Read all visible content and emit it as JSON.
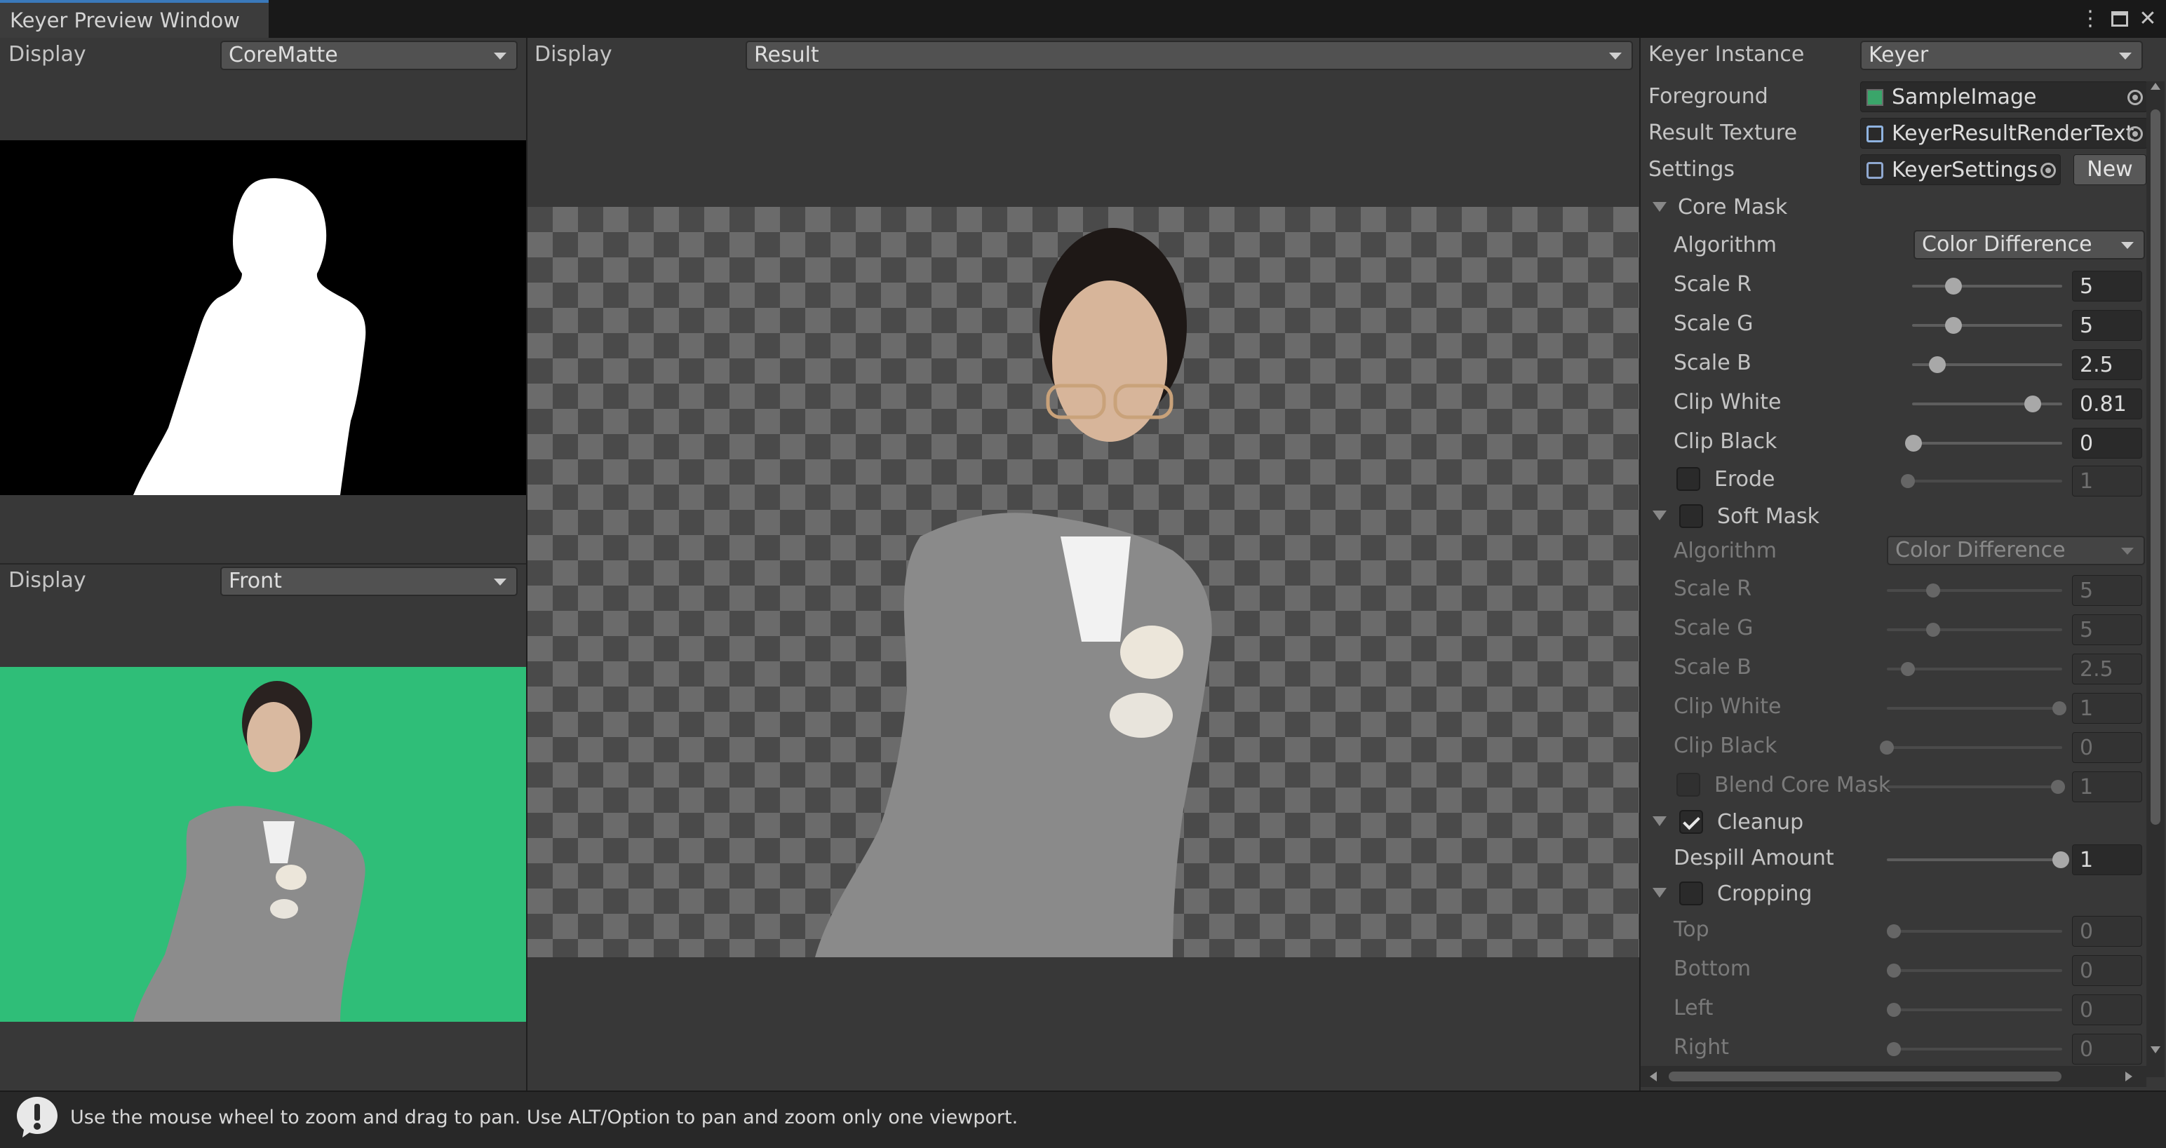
{
  "window": {
    "tab_title": "Keyer Preview Window"
  },
  "left_top": {
    "display_label": "Display",
    "display_value": "CoreMatte"
  },
  "left_bottom": {
    "display_label": "Display",
    "display_value": "Front"
  },
  "center": {
    "display_label": "Display",
    "display_value": "Result"
  },
  "inspector": {
    "instance_label": "Keyer Instance",
    "instance_value": "Keyer",
    "foreground_label": "Foreground",
    "foreground_value": "SampleImage",
    "result_label": "Result Texture",
    "result_value": "KeyerResultRenderText",
    "settings_label": "Settings",
    "settings_value": "KeyerSettings",
    "new_label": "New",
    "core_mask": {
      "title": "Core Mask",
      "algorithm_label": "Algorithm",
      "algorithm_value": "Color Difference",
      "sliders": [
        {
          "label": "Scale R",
          "value": "5",
          "fraction": 0.27
        },
        {
          "label": "Scale G",
          "value": "5",
          "fraction": 0.27
        },
        {
          "label": "Scale B",
          "value": "2.5",
          "fraction": 0.16
        },
        {
          "label": "Clip White",
          "value": "0.81",
          "fraction": 0.81
        },
        {
          "label": "Clip Black",
          "value": "0",
          "fraction": 0.0
        }
      ],
      "erode_label": "Erode",
      "erode_value": "1"
    },
    "soft_mask": {
      "title": "Soft Mask",
      "algorithm_label": "Algorithm",
      "algorithm_value": "Color Difference",
      "sliders": [
        {
          "label": "Scale R",
          "value": "5",
          "fraction": 0.27
        },
        {
          "label": "Scale G",
          "value": "5",
          "fraction": 0.27
        },
        {
          "label": "Scale B",
          "value": "2.5",
          "fraction": 0.12
        },
        {
          "label": "Clip White",
          "value": "1",
          "fraction": 1.0
        },
        {
          "label": "Clip Black",
          "value": "0",
          "fraction": 0.0
        }
      ],
      "blend_label": "Blend Core Mask",
      "blend_value": "1"
    },
    "cleanup": {
      "title": "Cleanup",
      "despill_label": "Despill Amount",
      "despill_value": "1",
      "despill_fraction": 1.0
    },
    "cropping": {
      "title": "Cropping",
      "rows": [
        {
          "label": "Top",
          "value": "0"
        },
        {
          "label": "Bottom",
          "value": "0"
        },
        {
          "label": "Left",
          "value": "0"
        },
        {
          "label": "Right",
          "value": "0"
        }
      ]
    }
  },
  "status": {
    "message": "Use the mouse wheel to zoom and drag to pan. Use ALT/Option to pan and zoom only one viewport."
  }
}
